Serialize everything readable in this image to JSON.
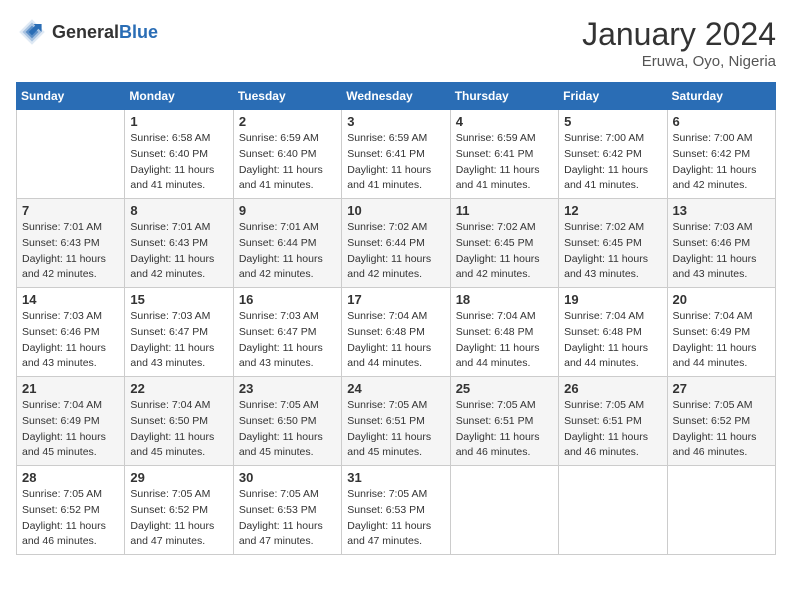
{
  "header": {
    "logo_general": "General",
    "logo_blue": "Blue",
    "month_year": "January 2024",
    "location": "Eruwa, Oyo, Nigeria"
  },
  "calendar": {
    "days_of_week": [
      "Sunday",
      "Monday",
      "Tuesday",
      "Wednesday",
      "Thursday",
      "Friday",
      "Saturday"
    ],
    "weeks": [
      [
        {
          "day": "",
          "sunrise": "",
          "sunset": "",
          "daylight": ""
        },
        {
          "day": "1",
          "sunrise": "Sunrise: 6:58 AM",
          "sunset": "Sunset: 6:40 PM",
          "daylight": "Daylight: 11 hours and 41 minutes."
        },
        {
          "day": "2",
          "sunrise": "Sunrise: 6:59 AM",
          "sunset": "Sunset: 6:40 PM",
          "daylight": "Daylight: 11 hours and 41 minutes."
        },
        {
          "day": "3",
          "sunrise": "Sunrise: 6:59 AM",
          "sunset": "Sunset: 6:41 PM",
          "daylight": "Daylight: 11 hours and 41 minutes."
        },
        {
          "day": "4",
          "sunrise": "Sunrise: 6:59 AM",
          "sunset": "Sunset: 6:41 PM",
          "daylight": "Daylight: 11 hours and 41 minutes."
        },
        {
          "day": "5",
          "sunrise": "Sunrise: 7:00 AM",
          "sunset": "Sunset: 6:42 PM",
          "daylight": "Daylight: 11 hours and 41 minutes."
        },
        {
          "day": "6",
          "sunrise": "Sunrise: 7:00 AM",
          "sunset": "Sunset: 6:42 PM",
          "daylight": "Daylight: 11 hours and 42 minutes."
        }
      ],
      [
        {
          "day": "7",
          "sunrise": "Sunrise: 7:01 AM",
          "sunset": "Sunset: 6:43 PM",
          "daylight": "Daylight: 11 hours and 42 minutes."
        },
        {
          "day": "8",
          "sunrise": "Sunrise: 7:01 AM",
          "sunset": "Sunset: 6:43 PM",
          "daylight": "Daylight: 11 hours and 42 minutes."
        },
        {
          "day": "9",
          "sunrise": "Sunrise: 7:01 AM",
          "sunset": "Sunset: 6:44 PM",
          "daylight": "Daylight: 11 hours and 42 minutes."
        },
        {
          "day": "10",
          "sunrise": "Sunrise: 7:02 AM",
          "sunset": "Sunset: 6:44 PM",
          "daylight": "Daylight: 11 hours and 42 minutes."
        },
        {
          "day": "11",
          "sunrise": "Sunrise: 7:02 AM",
          "sunset": "Sunset: 6:45 PM",
          "daylight": "Daylight: 11 hours and 42 minutes."
        },
        {
          "day": "12",
          "sunrise": "Sunrise: 7:02 AM",
          "sunset": "Sunset: 6:45 PM",
          "daylight": "Daylight: 11 hours and 43 minutes."
        },
        {
          "day": "13",
          "sunrise": "Sunrise: 7:03 AM",
          "sunset": "Sunset: 6:46 PM",
          "daylight": "Daylight: 11 hours and 43 minutes."
        }
      ],
      [
        {
          "day": "14",
          "sunrise": "Sunrise: 7:03 AM",
          "sunset": "Sunset: 6:46 PM",
          "daylight": "Daylight: 11 hours and 43 minutes."
        },
        {
          "day": "15",
          "sunrise": "Sunrise: 7:03 AM",
          "sunset": "Sunset: 6:47 PM",
          "daylight": "Daylight: 11 hours and 43 minutes."
        },
        {
          "day": "16",
          "sunrise": "Sunrise: 7:03 AM",
          "sunset": "Sunset: 6:47 PM",
          "daylight": "Daylight: 11 hours and 43 minutes."
        },
        {
          "day": "17",
          "sunrise": "Sunrise: 7:04 AM",
          "sunset": "Sunset: 6:48 PM",
          "daylight": "Daylight: 11 hours and 44 minutes."
        },
        {
          "day": "18",
          "sunrise": "Sunrise: 7:04 AM",
          "sunset": "Sunset: 6:48 PM",
          "daylight": "Daylight: 11 hours and 44 minutes."
        },
        {
          "day": "19",
          "sunrise": "Sunrise: 7:04 AM",
          "sunset": "Sunset: 6:48 PM",
          "daylight": "Daylight: 11 hours and 44 minutes."
        },
        {
          "day": "20",
          "sunrise": "Sunrise: 7:04 AM",
          "sunset": "Sunset: 6:49 PM",
          "daylight": "Daylight: 11 hours and 44 minutes."
        }
      ],
      [
        {
          "day": "21",
          "sunrise": "Sunrise: 7:04 AM",
          "sunset": "Sunset: 6:49 PM",
          "daylight": "Daylight: 11 hours and 45 minutes."
        },
        {
          "day": "22",
          "sunrise": "Sunrise: 7:04 AM",
          "sunset": "Sunset: 6:50 PM",
          "daylight": "Daylight: 11 hours and 45 minutes."
        },
        {
          "day": "23",
          "sunrise": "Sunrise: 7:05 AM",
          "sunset": "Sunset: 6:50 PM",
          "daylight": "Daylight: 11 hours and 45 minutes."
        },
        {
          "day": "24",
          "sunrise": "Sunrise: 7:05 AM",
          "sunset": "Sunset: 6:51 PM",
          "daylight": "Daylight: 11 hours and 45 minutes."
        },
        {
          "day": "25",
          "sunrise": "Sunrise: 7:05 AM",
          "sunset": "Sunset: 6:51 PM",
          "daylight": "Daylight: 11 hours and 46 minutes."
        },
        {
          "day": "26",
          "sunrise": "Sunrise: 7:05 AM",
          "sunset": "Sunset: 6:51 PM",
          "daylight": "Daylight: 11 hours and 46 minutes."
        },
        {
          "day": "27",
          "sunrise": "Sunrise: 7:05 AM",
          "sunset": "Sunset: 6:52 PM",
          "daylight": "Daylight: 11 hours and 46 minutes."
        }
      ],
      [
        {
          "day": "28",
          "sunrise": "Sunrise: 7:05 AM",
          "sunset": "Sunset: 6:52 PM",
          "daylight": "Daylight: 11 hours and 46 minutes."
        },
        {
          "day": "29",
          "sunrise": "Sunrise: 7:05 AM",
          "sunset": "Sunset: 6:52 PM",
          "daylight": "Daylight: 11 hours and 47 minutes."
        },
        {
          "day": "30",
          "sunrise": "Sunrise: 7:05 AM",
          "sunset": "Sunset: 6:53 PM",
          "daylight": "Daylight: 11 hours and 47 minutes."
        },
        {
          "day": "31",
          "sunrise": "Sunrise: 7:05 AM",
          "sunset": "Sunset: 6:53 PM",
          "daylight": "Daylight: 11 hours and 47 minutes."
        },
        {
          "day": "",
          "sunrise": "",
          "sunset": "",
          "daylight": ""
        },
        {
          "day": "",
          "sunrise": "",
          "sunset": "",
          "daylight": ""
        },
        {
          "day": "",
          "sunrise": "",
          "sunset": "",
          "daylight": ""
        }
      ]
    ]
  }
}
